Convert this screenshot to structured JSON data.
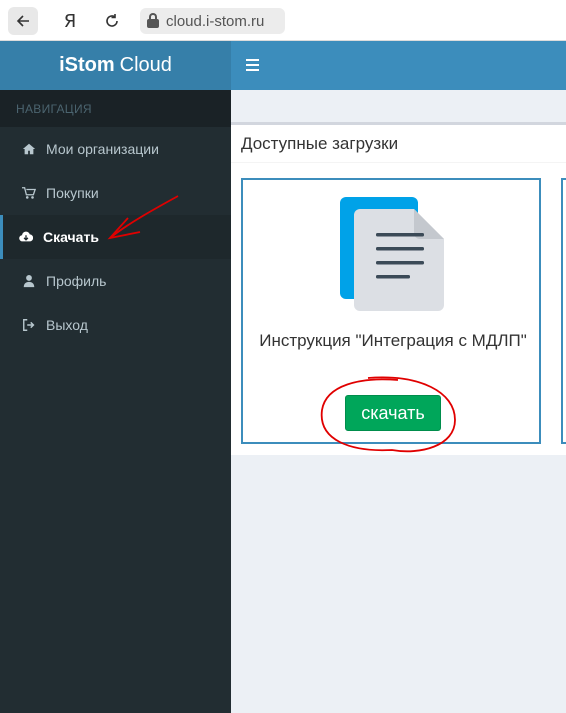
{
  "browser": {
    "ya_label": "Я",
    "url": "cloud.i-stom.ru"
  },
  "sidebar": {
    "logo_bold": "iStom",
    "logo_rest": "Cloud",
    "nav_header": "НАВИГАЦИЯ",
    "items": [
      {
        "label": "Мои организации",
        "icon": "home-icon",
        "active": false
      },
      {
        "label": "Покупки",
        "icon": "cart-icon",
        "active": false
      },
      {
        "label": "Скачать",
        "icon": "cloud-download-icon",
        "active": true
      },
      {
        "label": "Профиль",
        "icon": "user-icon",
        "active": false
      },
      {
        "label": "Выход",
        "icon": "sign-out-icon",
        "active": false
      }
    ]
  },
  "main": {
    "box_title": "Доступные загрузки",
    "cards": [
      {
        "title": "Инструкция \"Интеграция с МДЛП\"",
        "button_label": "скачать"
      }
    ]
  },
  "colors": {
    "sidebar_bg": "#222d32",
    "logo_bg": "#367fa9",
    "topbar_bg": "#3c8dbc",
    "button_green": "#00a65a",
    "annotation_red": "#e00000"
  }
}
